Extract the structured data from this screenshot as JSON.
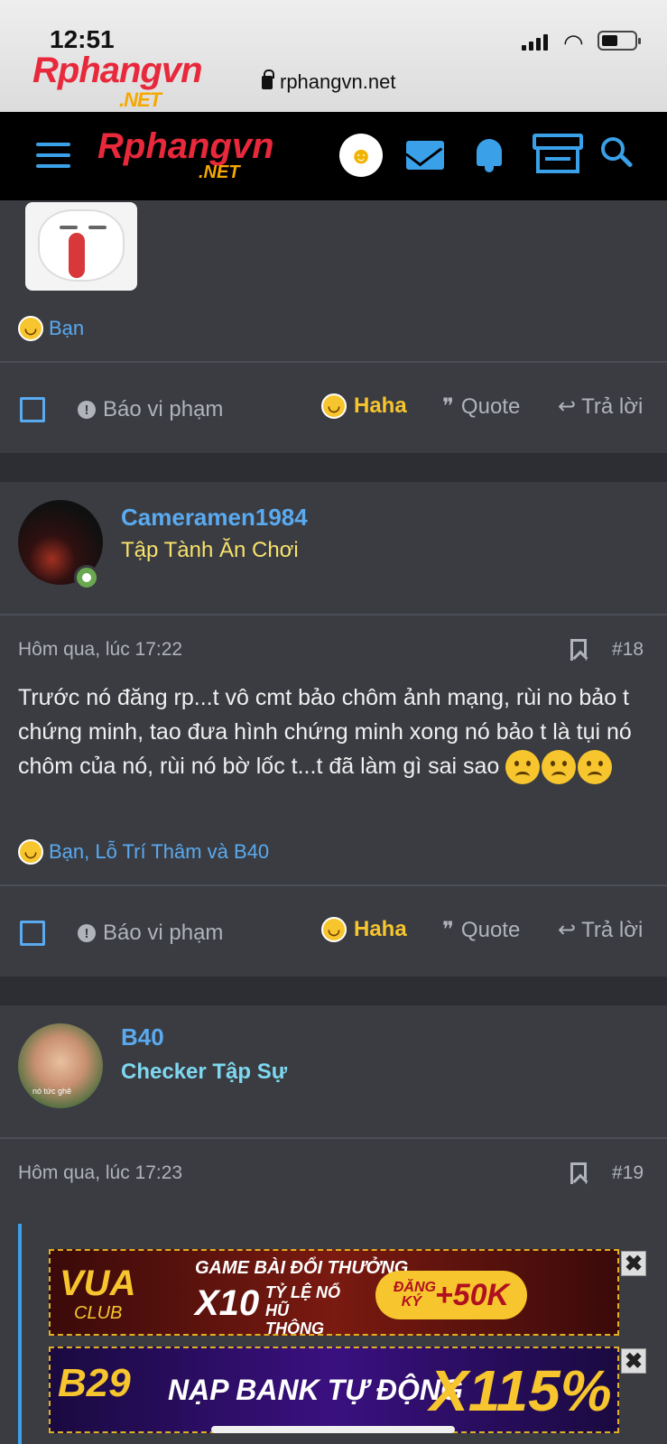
{
  "status": {
    "time": "12:51"
  },
  "browser": {
    "site_logo": "Rphangvn",
    "site_logo_sub": ".NET",
    "url": "rphangvn.net"
  },
  "nav": {
    "logo": "Rphangvn",
    "logo_sub": ".NET"
  },
  "post17": {
    "reactors": "Bạn",
    "actions": {
      "report": "Báo vi phạm",
      "haha": "Haha",
      "quote": "Quote",
      "reply": "Trả lời"
    }
  },
  "post18": {
    "username": "Cameramen1984",
    "usertitle": "Tập Tành Ăn Chơi",
    "usertitle_color": "#f7e26b",
    "date": "Hôm qua, lúc 17:22",
    "number": "#18",
    "body": "Trước nó đăng rp...t vô cmt bảo chôm ảnh mạng, rùi no bảo t chứng minh, tao đưa hình chứng minh xong nó bảo t là tụi nó chôm của nó, rùi nó bờ lốc t...t đã làm gì sai sao",
    "body_emojis": [
      "sad-face",
      "sad-face",
      "sad-face"
    ],
    "reactors": "Bạn, Lỗ Trí Thâm và B40",
    "actions": {
      "report": "Báo vi phạm",
      "haha": "Haha",
      "quote": "Quote",
      "reply": "Trả lời"
    }
  },
  "post19": {
    "username": "B40",
    "usertitle": "Checker Tập Sự",
    "usertitle_color": "#7fd8f0",
    "avatar_caption": "nó tức ghê",
    "date": "Hôm qua, lúc 17:23",
    "number": "#19"
  },
  "ads": {
    "ad1": {
      "logo": "VUA",
      "logo_sub": "CLUB",
      "line1": "GAME BÀI ĐỔI THƯỞNG",
      "multiplier": "X10",
      "line2": "TỶ LỆ NỔ HŨ THÔNG THƯỜNG",
      "cta_label": "ĐĂNG KÝ",
      "cta_bonus": "+50K"
    },
    "ad2": {
      "logo": "B29",
      "text": "NẠP BANK TỰ ĐỘNG",
      "bonus": "X115%"
    },
    "close_label": "✖"
  },
  "colors": {
    "accent": "#3aa0e8",
    "link": "#5aaaf0",
    "haha": "#f7c52d"
  }
}
